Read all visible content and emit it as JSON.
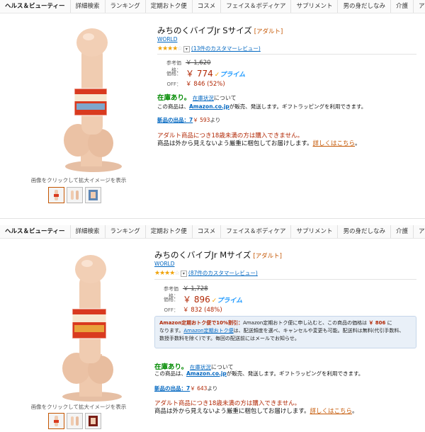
{
  "nav": [
    "ヘルス＆ビューティー",
    "詳細検索",
    "ランキング",
    "定期おトク便",
    "コスメ",
    "フェイス＆ボディケア",
    "サプリメント",
    "男の身だしなみ",
    "介護",
    "アダルトグッズ"
  ],
  "caption": "画像をクリックして拡大イメージを表示",
  "labels": {
    "list": "参考価格：",
    "price": "価格：",
    "off": "OFF：",
    "prime": "プライム",
    "in_stock": "在庫あり。",
    "stock_link": "在庫状況",
    "stock_suffix": "について",
    "sold_prefix": "この商品は、",
    "sold_link": "Amazon.co.jp",
    "sold_suffix": "が販売、発送します。ギフトラッピングを利用できます。",
    "new_link": "新品の出品：",
    "new_suffix": "より",
    "adult_tag": "[アダルト]",
    "warn1": "アダルト商品につき18歳未満の方は購入できません。",
    "warn2": "商品は外から見えないよう厳重に梱包してお届けします。",
    "warn_link": "詳しくはこちら",
    "reviews_suffix": "件のカスタマーレビュー"
  },
  "products": [
    {
      "title": "みちのくバイブJr Sサイズ",
      "brand": "WORLD",
      "rating": 4,
      "reviews": "13",
      "list_price": "￥ 1,620",
      "price": "￥ 774",
      "off": "￥ 846 (52%)",
      "new_count": "7",
      "new_price": "593"
    },
    {
      "title": "みちのくバイブJr Mサイズ",
      "brand": "WORLD",
      "rating": 4,
      "reviews": "87",
      "list_price": "￥ 1,728",
      "price": "￥ 896",
      "off": "￥ 832 (48%)",
      "new_count": "7",
      "new_price": "643"
    }
  ],
  "subscribe": {
    "lead": "Amazon定期おトク便で10%割引：",
    "text1": "Amazon定期おトク便に申し込むと、この商品の価格は",
    "fee": "￥ 806",
    "text2": "に",
    "text3": "なります。",
    "link": "Amazon定期おトク便",
    "text4": "は、配送頻度を選べ、キャンセルや変更も可能。配送料は無料(代引手数料、",
    "text5": "数授手数料を除く)です。毎回の配送前にはメールでお知らせ。"
  },
  "colors": {
    "price": "#b12704",
    "link": "#0066c0",
    "stock": "#008a00",
    "star": "#f0a30a",
    "accent": "#c45500"
  }
}
